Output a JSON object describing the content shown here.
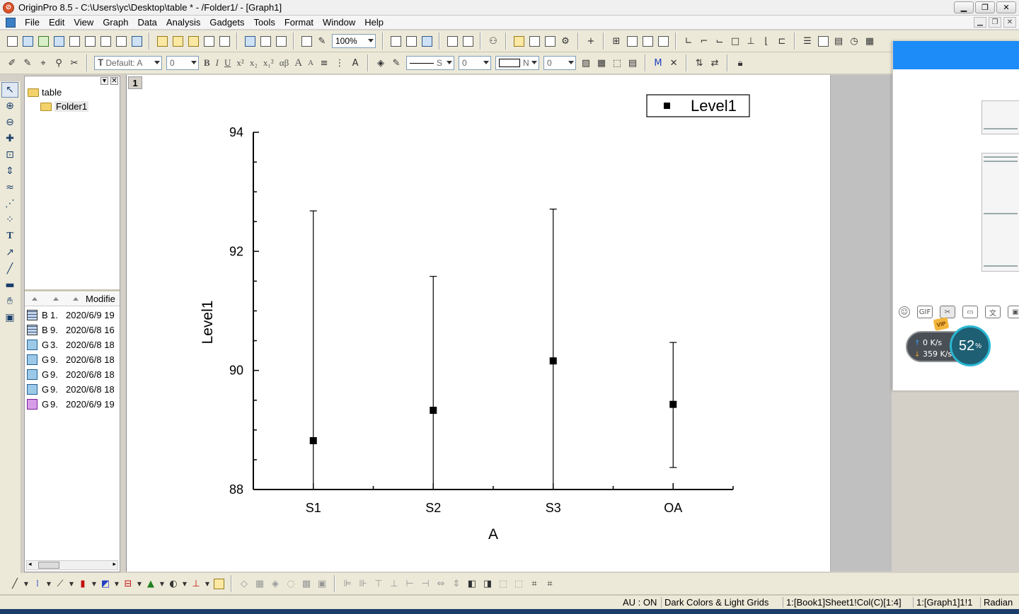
{
  "window": {
    "title": "OriginPro 8.5 - C:\\Users\\yc\\Desktop\\table * - /Folder1/ - [Graph1]",
    "app_icon": "origin-logo-icon"
  },
  "menu": [
    "File",
    "Edit",
    "View",
    "Graph",
    "Data",
    "Analysis",
    "Gadgets",
    "Tools",
    "Format",
    "Window",
    "Help"
  ],
  "toolbar": {
    "zoom": "100%",
    "font": "Default: A",
    "font_size": "0",
    "text_styles": [
      "B",
      "I",
      "U",
      "x²",
      "x₂",
      "x₁²",
      "αβ",
      "A",
      "A"
    ],
    "line_style": "S",
    "line_width": "0",
    "pattern": "N",
    "pattern_width": "0"
  },
  "explorer": {
    "root": "table",
    "folder": "Folder1",
    "columns": {
      "modified": "Modifie"
    },
    "files": [
      {
        "icon": "workbook-icon",
        "name": "B",
        "size": "1.",
        "modified": "2020/6/9 19"
      },
      {
        "icon": "workbook-icon",
        "name": "B",
        "size": "9.",
        "modified": "2020/6/8 16"
      },
      {
        "icon": "graph-icon",
        "name": "G",
        "size": "3.",
        "modified": "2020/6/8 18"
      },
      {
        "icon": "graph-icon",
        "name": "G",
        "size": "9.",
        "modified": "2020/6/8 18"
      },
      {
        "icon": "graph-icon",
        "name": "G",
        "size": "9.",
        "modified": "2020/6/8 18"
      },
      {
        "icon": "graph-icon",
        "name": "G",
        "size": "9.",
        "modified": "2020/6/8 18"
      },
      {
        "icon": "graph-layout-icon",
        "name": "G",
        "size": "9.",
        "modified": "2020/6/9 19"
      }
    ]
  },
  "graph": {
    "layer_tab": "1"
  },
  "chart_data": {
    "type": "scatter",
    "categories": [
      "S1",
      "S2",
      "S3",
      "OA"
    ],
    "series": [
      {
        "name": "Level1",
        "values": [
          88.82,
          89.33,
          90.16,
          89.43
        ],
        "error_low": [
          88.0,
          88.0,
          88.0,
          88.37
        ],
        "error_high": [
          92.68,
          91.58,
          92.71,
          90.47
        ]
      }
    ],
    "xlabel": "A",
    "ylabel": "Level1",
    "ylim": [
      88,
      94
    ],
    "yticks": [
      "88",
      "90",
      "92",
      "94"
    ],
    "grid": false,
    "legend": "top-right",
    "color": "#000000"
  },
  "overlay": {
    "upload_rate": "0 K/s",
    "download_rate": "359 K/s",
    "percent": "52",
    "percent_unit": "%",
    "vip_badge": "VIP",
    "accent": "#1d8cf8"
  },
  "status": {
    "au": "AU : ON",
    "theme": "Dark Colors & Light Grids",
    "cell": "1:[Book1]Sheet1!Col(C)[1:4]",
    "layer": "1:[Graph1]1!1",
    "angle": "Radian"
  }
}
